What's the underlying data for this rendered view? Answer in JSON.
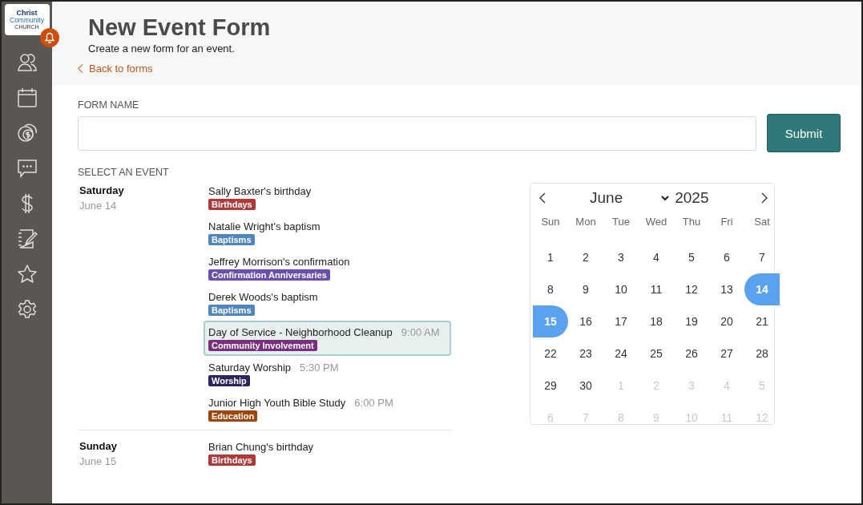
{
  "logo": {
    "line1": "Christ",
    "line2": "Community",
    "line3": "CHURCH"
  },
  "sidebar": {
    "items": [
      {
        "kind": "people"
      },
      {
        "kind": "calendar"
      },
      {
        "kind": "coins"
      },
      {
        "kind": "chat"
      },
      {
        "kind": "dollar"
      },
      {
        "kind": "notebook"
      },
      {
        "kind": "star"
      },
      {
        "kind": "settings"
      }
    ]
  },
  "header": {
    "title": "New Event Form",
    "subtitle": "Create a new form for an event.",
    "back_link": "Back to forms"
  },
  "form": {
    "name_label": "FORM NAME",
    "submit": "Submit",
    "select_label": "SELECT AN EVENT"
  },
  "groups": [
    {
      "day": "Saturday",
      "date": "June 14",
      "events": [
        {
          "title": "Sally Baxter's birthday",
          "tag": "Birthdays",
          "color": "#b03a3a",
          "selected": false
        },
        {
          "title": "Natalie Wright's baptism",
          "tag": "Baptisms",
          "color": "#4f86bf",
          "selected": false
        },
        {
          "title": "Jeffrey Morrison's confirmation",
          "tag": "Confirmation Anniversaries",
          "color": "#6a4fae",
          "selected": false
        },
        {
          "title": "Derek Woods's baptism",
          "tag": "Baptisms",
          "color": "#4f86bf",
          "selected": false
        },
        {
          "title": "Day of Service - Neighborhood Cleanup",
          "time": "9:00 AM",
          "tag": "Community Involvement",
          "color": "#7a2e7e",
          "selected": true
        },
        {
          "title": "Saturday Worship",
          "time": "5:30 PM",
          "tag": "Worship",
          "color": "#2e2360",
          "selected": false
        },
        {
          "title": "Junior High Youth Bible Study",
          "time": "6:00 PM",
          "tag": "Education",
          "color": "#a0460d",
          "selected": false
        }
      ]
    },
    {
      "day": "Sunday",
      "date": "June 15",
      "events": [
        {
          "title": "Brian Chung's birthday",
          "tag": "Birthdays",
          "color": "#b03a3a",
          "selected": false
        }
      ]
    }
  ],
  "calendar": {
    "month": "June",
    "year": "2025",
    "weekdays": [
      "Sun",
      "Mon",
      "Tue",
      "Wed",
      "Thu",
      "Fri",
      "Sat"
    ],
    "days": [
      {
        "label": "1",
        "muted": false,
        "selected": false
      },
      {
        "label": "2",
        "muted": false,
        "selected": false
      },
      {
        "label": "3",
        "muted": false,
        "selected": false
      },
      {
        "label": "4",
        "muted": false,
        "selected": false
      },
      {
        "label": "5",
        "muted": false,
        "selected": false
      },
      {
        "label": "6",
        "muted": false,
        "selected": false
      },
      {
        "label": "7",
        "muted": false,
        "selected": false
      },
      {
        "label": "8",
        "muted": false,
        "selected": false
      },
      {
        "label": "9",
        "muted": false,
        "selected": false
      },
      {
        "label": "10",
        "muted": false,
        "selected": false
      },
      {
        "label": "11",
        "muted": false,
        "selected": false
      },
      {
        "label": "12",
        "muted": false,
        "selected": false
      },
      {
        "label": "13",
        "muted": false,
        "selected": false
      },
      {
        "label": "14",
        "muted": false,
        "selected": true
      },
      {
        "label": "15",
        "muted": false,
        "selected": true
      },
      {
        "label": "16",
        "muted": false,
        "selected": false
      },
      {
        "label": "17",
        "muted": false,
        "selected": false
      },
      {
        "label": "18",
        "muted": false,
        "selected": false
      },
      {
        "label": "19",
        "muted": false,
        "selected": false
      },
      {
        "label": "20",
        "muted": false,
        "selected": false
      },
      {
        "label": "21",
        "muted": false,
        "selected": false
      },
      {
        "label": "22",
        "muted": false,
        "selected": false
      },
      {
        "label": "23",
        "muted": false,
        "selected": false
      },
      {
        "label": "24",
        "muted": false,
        "selected": false
      },
      {
        "label": "25",
        "muted": false,
        "selected": false
      },
      {
        "label": "26",
        "muted": false,
        "selected": false
      },
      {
        "label": "27",
        "muted": false,
        "selected": false
      },
      {
        "label": "28",
        "muted": false,
        "selected": false
      },
      {
        "label": "29",
        "muted": false,
        "selected": false
      },
      {
        "label": "30",
        "muted": false,
        "selected": false
      },
      {
        "label": "1",
        "muted": true,
        "selected": false
      },
      {
        "label": "2",
        "muted": true,
        "selected": false
      },
      {
        "label": "3",
        "muted": true,
        "selected": false
      },
      {
        "label": "4",
        "muted": true,
        "selected": false
      },
      {
        "label": "5",
        "muted": true,
        "selected": false
      },
      {
        "label": "6",
        "muted": true,
        "selected": false
      },
      {
        "label": "7",
        "muted": true,
        "selected": false
      },
      {
        "label": "8",
        "muted": true,
        "selected": false
      },
      {
        "label": "9",
        "muted": true,
        "selected": false
      },
      {
        "label": "10",
        "muted": true,
        "selected": false
      },
      {
        "label": "11",
        "muted": true,
        "selected": false
      },
      {
        "label": "12",
        "muted": true,
        "selected": false
      }
    ]
  }
}
